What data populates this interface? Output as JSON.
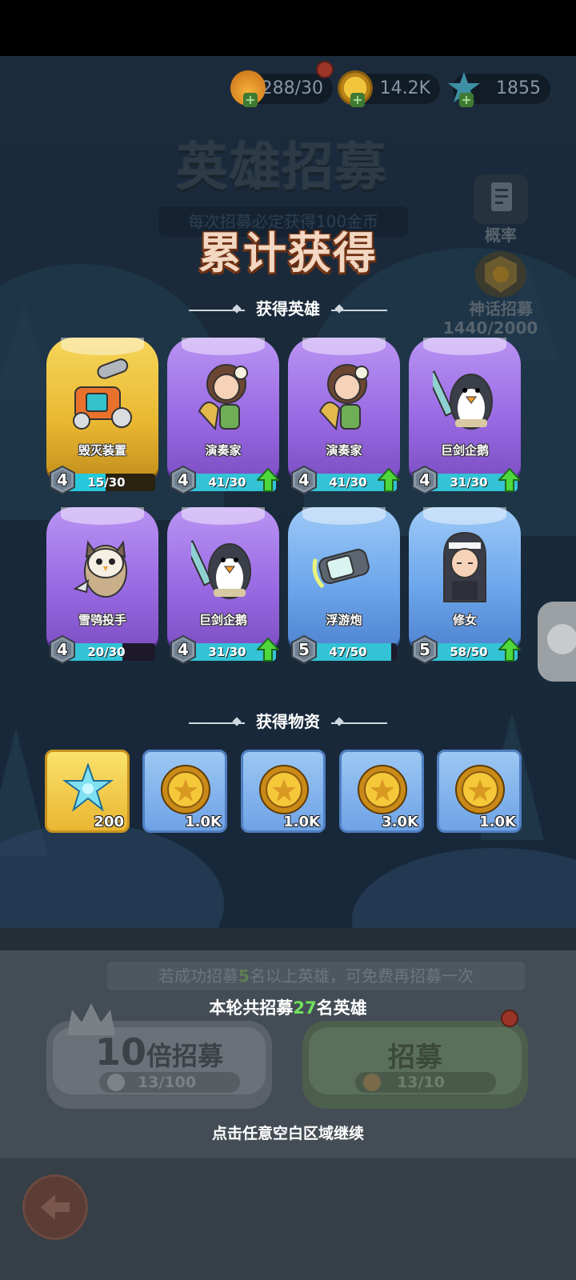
{
  "currencies": [
    {
      "name": "stamina",
      "value": "288/30",
      "icon": "flame-icon",
      "color": "#e58a1e"
    },
    {
      "name": "gold",
      "value": "14.2K",
      "icon": "gold-coin-icon",
      "color": "#d9a41f"
    },
    {
      "name": "crystal",
      "value": "1855",
      "icon": "snowflake-crystal-icon",
      "color": "#4fb3c8"
    }
  ],
  "background": {
    "title": "英雄招募",
    "subtitle": "每次招募必定获得100金币",
    "prob_label": "概率",
    "myth_label": "神话招募",
    "myth_progress": "1440/2000"
  },
  "overlay": {
    "title": "累计获得",
    "heroes_section": "获得英雄",
    "items_section": "获得物资"
  },
  "heroes": [
    {
      "name": "毁灭装置",
      "level": "4",
      "count": "15/30",
      "progress": 0.5,
      "rarity": "gold",
      "upgrade": false,
      "art": "cannon-machine-icon"
    },
    {
      "name": "演奏家",
      "level": "4",
      "count": "41/30",
      "progress": 1.0,
      "rarity": "purple",
      "upgrade": true,
      "art": "harp-girl-icon"
    },
    {
      "name": "演奏家",
      "level": "4",
      "count": "41/30",
      "progress": 1.0,
      "rarity": "purple",
      "upgrade": true,
      "art": "harp-girl-icon"
    },
    {
      "name": "巨剑企鹅",
      "level": "4",
      "count": "31/30",
      "progress": 1.0,
      "rarity": "purple",
      "upgrade": true,
      "art": "sword-penguin-icon"
    },
    {
      "name": "雪鸮投手",
      "level": "4",
      "count": "20/30",
      "progress": 0.667,
      "rarity": "purple",
      "upgrade": false,
      "art": "snow-owl-icon"
    },
    {
      "name": "巨剑企鹅",
      "level": "4",
      "count": "31/30",
      "progress": 1.0,
      "rarity": "purple",
      "upgrade": true,
      "art": "sword-penguin-icon"
    },
    {
      "name": "浮游炮",
      "level": "5",
      "count": "47/50",
      "progress": 0.94,
      "rarity": "blue",
      "upgrade": false,
      "art": "floating-cannon-icon"
    },
    {
      "name": "修女",
      "level": "5",
      "count": "58/50",
      "progress": 1.0,
      "rarity": "blue",
      "upgrade": true,
      "art": "nun-icon"
    }
  ],
  "items": [
    {
      "amount": "200",
      "icon": "snowflake-crystal-icon",
      "rarity": "gold"
    },
    {
      "amount": "1.0K",
      "icon": "gold-coin-icon",
      "rarity": "blue"
    },
    {
      "amount": "1.0K",
      "icon": "gold-coin-icon",
      "rarity": "blue"
    },
    {
      "amount": "3.0K",
      "icon": "gold-coin-icon",
      "rarity": "blue"
    },
    {
      "amount": "1.0K",
      "icon": "gold-coin-icon",
      "rarity": "blue"
    }
  ],
  "bottom": {
    "bonus_prefix": "若成功招募",
    "bonus_number": "5",
    "bonus_suffix": "名以上英雄，可免费再招募一次",
    "total_prefix": "本轮共招募",
    "total_number": "27",
    "total_suffix": "名英雄",
    "ten_x_num": "10",
    "ten_x_label": "倍招募",
    "ten_x_cost": "13/100",
    "recruit_label": "招募",
    "recruit_cost": "13/10",
    "continue_hint": "点击任意空白区域继续"
  },
  "colors": {
    "gold_card": "#e9b731",
    "purple_card": "#9a6be3",
    "blue_card": "#6ea7ec",
    "progress_fill": "#33c2d6",
    "upgrade_arrow": "#4fd83c",
    "highlight_number": "#6fe25d"
  }
}
